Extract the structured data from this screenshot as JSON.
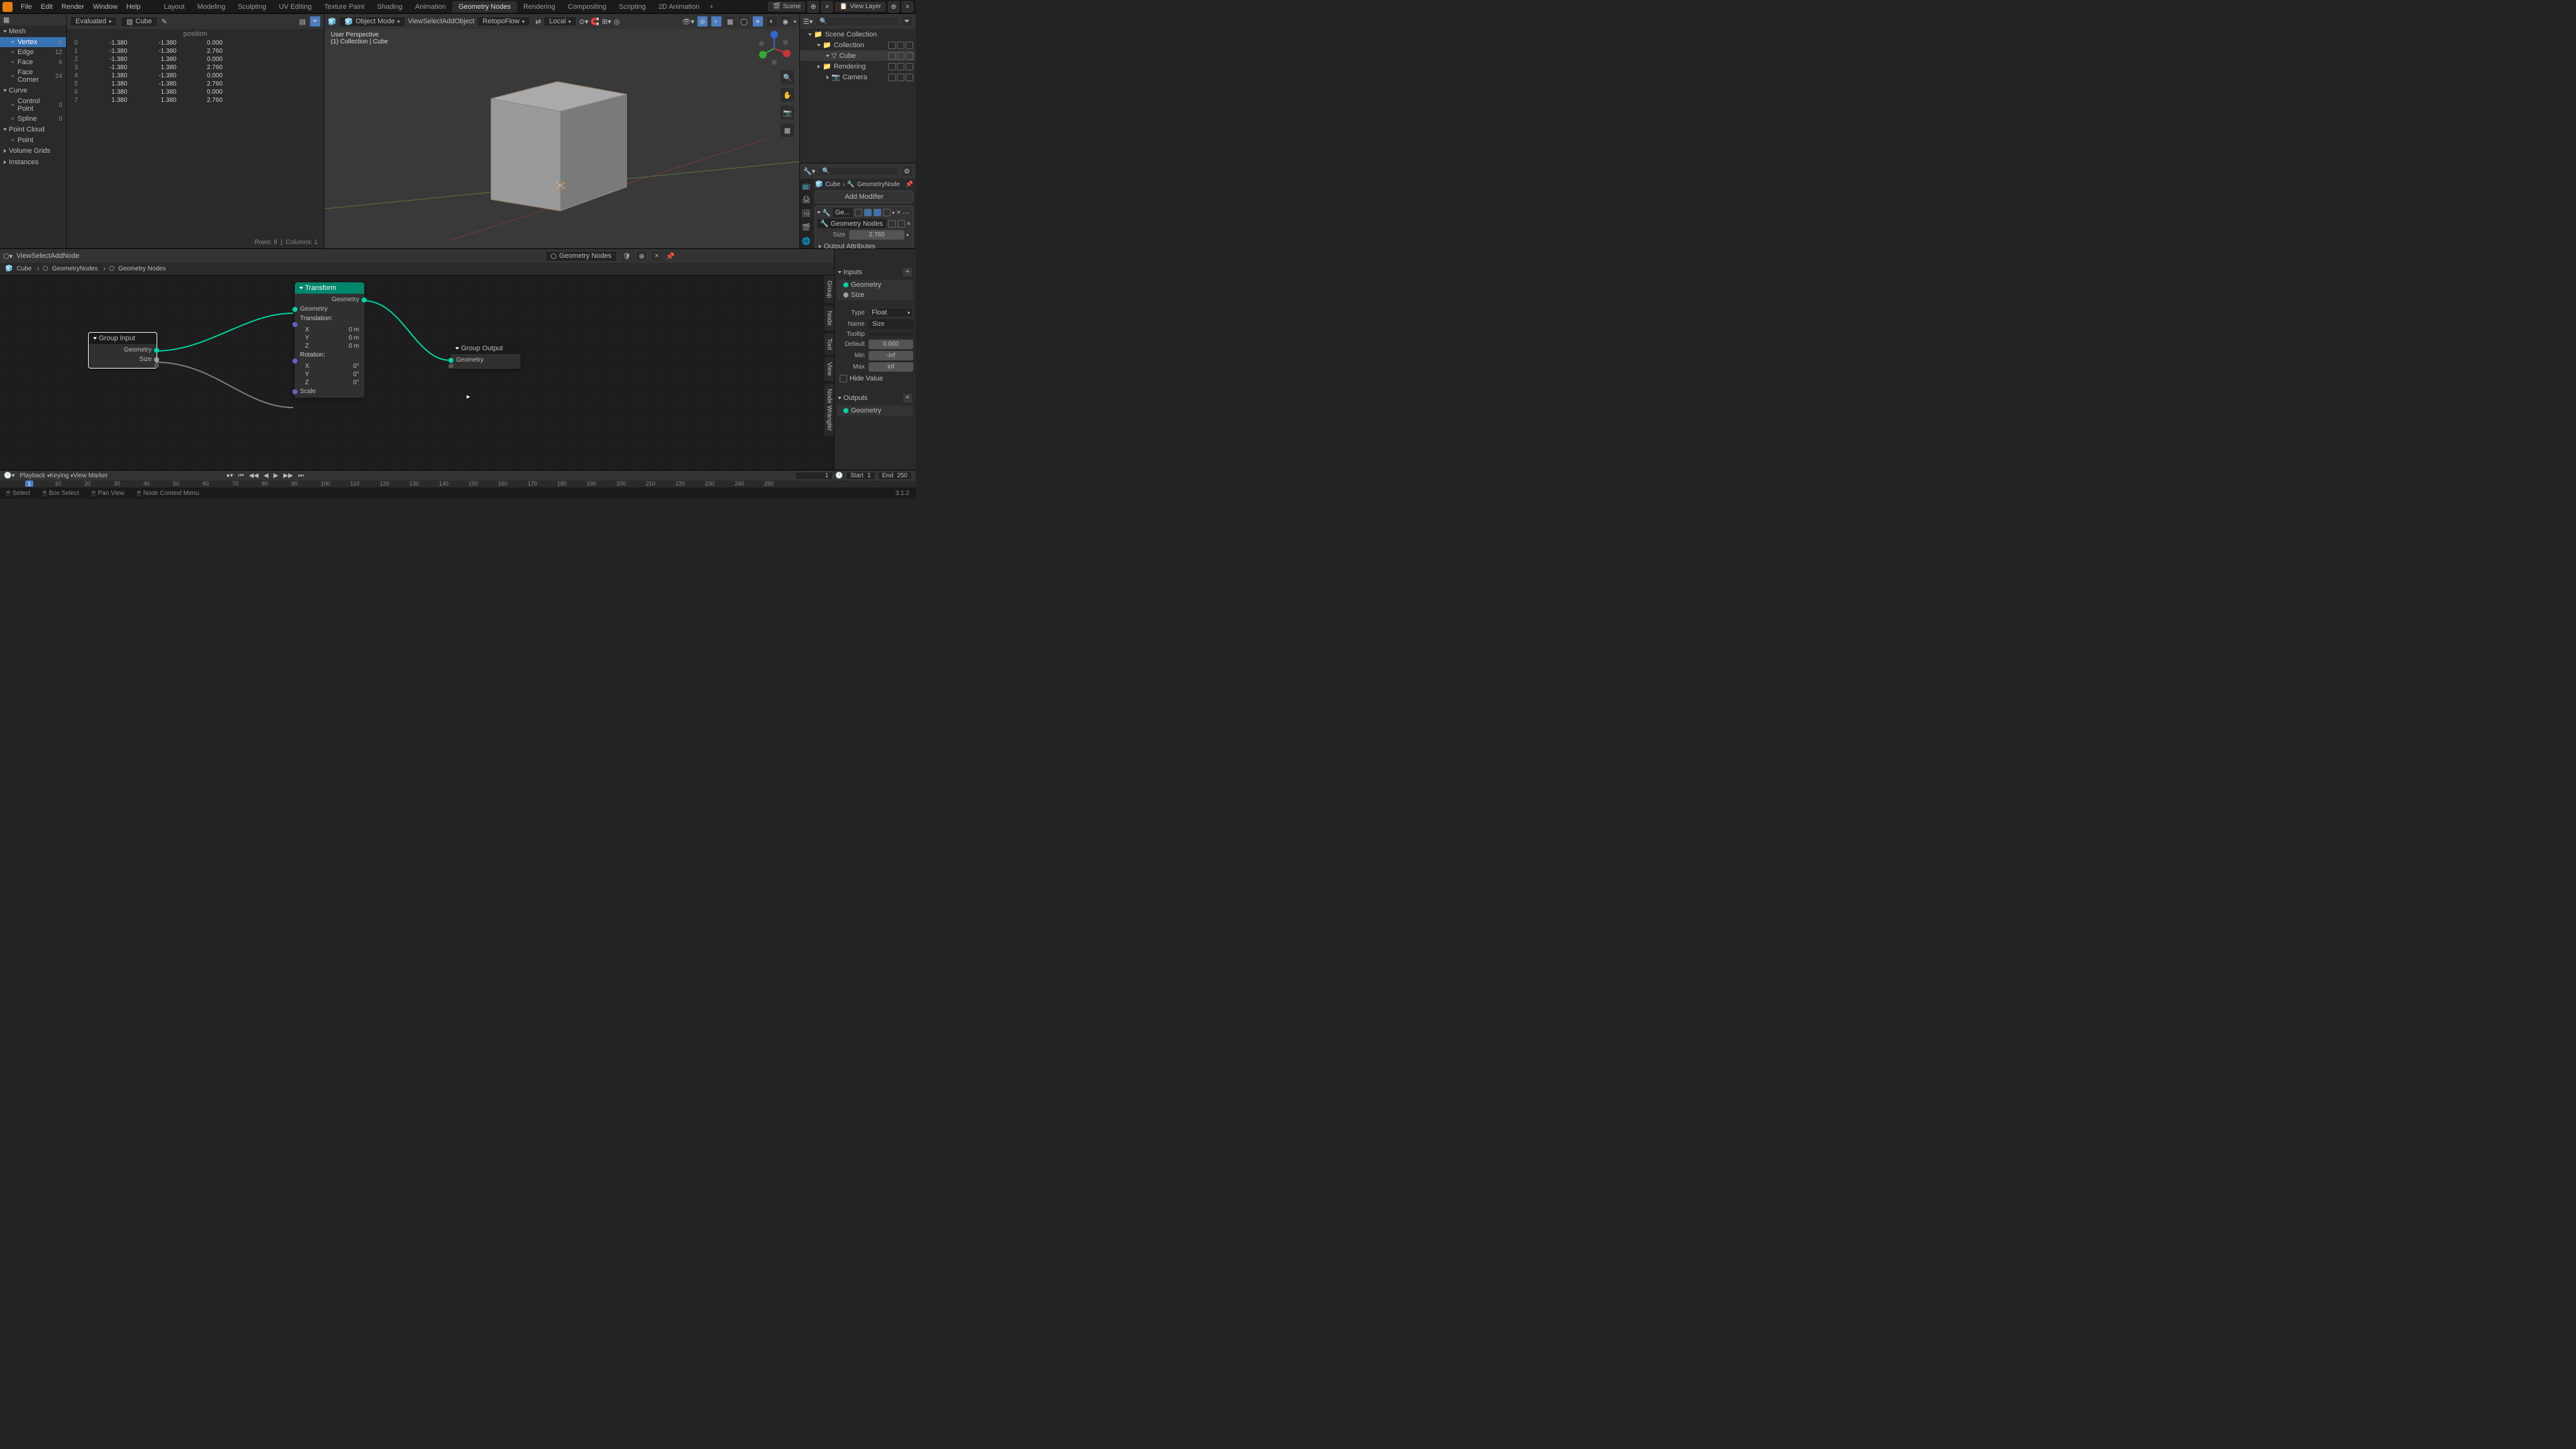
{
  "menu": [
    "File",
    "Edit",
    "Render",
    "Window",
    "Help"
  ],
  "tabs": [
    "Layout",
    "Modeling",
    "Sculpting",
    "UV Editing",
    "Texture Paint",
    "Shading",
    "Animation",
    "Geometry Nodes",
    "Rendering",
    "Compositing",
    "Scripting",
    "2D Animation"
  ],
  "active_tab": "Geometry Nodes",
  "scene": "Scene",
  "view_layer": "View Layer",
  "spreadsheet": {
    "mode": "Evaluated",
    "object": "Cube",
    "column": "position",
    "rows_label": "Rows: 8",
    "cols_label": "Columns: 1",
    "mesh": {
      "title": "Mesh",
      "items": [
        {
          "label": "Vertex",
          "count": "8"
        },
        {
          "label": "Edge",
          "count": "12"
        },
        {
          "label": "Face",
          "count": "6"
        },
        {
          "label": "Face Corner",
          "count": "24"
        }
      ]
    },
    "curve": {
      "title": "Curve",
      "items": [
        {
          "label": "Control Point",
          "count": "0"
        },
        {
          "label": "Spline",
          "count": "0"
        }
      ]
    },
    "pointcloud": {
      "title": "Point Cloud",
      "items": [
        {
          "label": "Point",
          "count": ""
        }
      ]
    },
    "volume": {
      "title": "Volume Grids"
    },
    "instances": {
      "title": "Instances"
    },
    "data": [
      [
        "0",
        "-1.380",
        "-1.380",
        "0.000"
      ],
      [
        "1",
        "-1.380",
        "-1.380",
        "2.760"
      ],
      [
        "2",
        "-1.380",
        "1.380",
        "0.000"
      ],
      [
        "3",
        "-1.380",
        "1.380",
        "2.760"
      ],
      [
        "4",
        "1.380",
        "-1.380",
        "0.000"
      ],
      [
        "5",
        "1.380",
        "-1.380",
        "2.760"
      ],
      [
        "6",
        "1.380",
        "1.380",
        "0.000"
      ],
      [
        "7",
        "1.380",
        "1.380",
        "2.760"
      ]
    ]
  },
  "view3d": {
    "menu": [
      "View",
      "Select",
      "Add",
      "Object"
    ],
    "mode": "Object Mode",
    "retopo": "RetopoFlow",
    "orient": "Local",
    "overlay1": "User Perspective",
    "overlay2": "(1) Collection | Cube"
  },
  "outliner": {
    "root": "Scene Collection",
    "items": [
      {
        "label": "Collection",
        "icon": "collection"
      },
      {
        "label": "Cube",
        "icon": "mesh",
        "selected": true
      },
      {
        "label": "Rendering",
        "icon": "collection"
      },
      {
        "label": "Camera",
        "icon": "camera"
      }
    ]
  },
  "props": {
    "breadcrumb": [
      "Cube",
      "GeometryNode"
    ],
    "add_modifier": "Add Modifier",
    "mod_label": "Ge...",
    "gn_label": "Geometry Nodes",
    "size_label": "Size",
    "size_value": "2.760",
    "output_attrs": "Output Attributes"
  },
  "nodeeditor": {
    "menu": [
      "View",
      "Select",
      "Add",
      "Node"
    ],
    "tree_name": "Geometry Nodes",
    "breadcrumb": [
      "Cube",
      "GeometryNodes",
      "Geometry Nodes"
    ],
    "group_input": {
      "title": "Group Input",
      "outs": [
        {
          "label": "Geometry",
          "type": "geo"
        },
        {
          "label": "Size",
          "type": "flt"
        }
      ]
    },
    "transform": {
      "title": "Transform",
      "out": {
        "label": "Geometry",
        "type": "geo"
      },
      "in_geo": {
        "label": "Geometry",
        "type": "geo"
      },
      "translation": {
        "label": "Translation:",
        "x": "X",
        "xv": "0 m",
        "y": "Y",
        "yv": "0 m",
        "z": "Z",
        "zv": "0 m"
      },
      "rotation": {
        "label": "Rotation:",
        "x": "X",
        "xv": "0°",
        "y": "Y",
        "yv": "0°",
        "z": "Z",
        "zv": "0°"
      },
      "scale": {
        "label": "Scale",
        "type": "vec"
      }
    },
    "group_output": {
      "title": "Group Output",
      "in": {
        "label": "Geometry",
        "type": "geo"
      }
    },
    "sidepanel": {
      "inputs_title": "Inputs",
      "inputs": [
        {
          "label": "Geometry",
          "type": "geo"
        },
        {
          "label": "Size",
          "type": "flt"
        }
      ],
      "type_label": "Type",
      "type_val": "Float",
      "name_label": "Name",
      "name_val": "Size",
      "tooltip_label": "Tooltip",
      "tooltip_val": "",
      "default_label": "Default",
      "default_val": "0.000",
      "min_label": "Min",
      "min_val": "-inf",
      "max_label": "Max",
      "max_val": "inf",
      "hide": "Hide Value",
      "outputs_title": "Outputs",
      "outputs": [
        {
          "label": "Geometry",
          "type": "geo"
        }
      ]
    },
    "side_tabs": [
      "Group",
      "Node",
      "Tool",
      "View",
      "Node Wrangler"
    ]
  },
  "timeline": {
    "menu": [
      "Playback",
      "Keying",
      "View",
      "Marker"
    ],
    "current": "1",
    "start_label": "Start",
    "start": "1",
    "end_label": "End",
    "end": "250",
    "ticks": [
      "10",
      "20",
      "30",
      "40",
      "50",
      "60",
      "70",
      "80",
      "90",
      "100",
      "110",
      "120",
      "130",
      "140",
      "150",
      "160",
      "170",
      "180",
      "190",
      "200",
      "210",
      "220",
      "230",
      "240",
      "250"
    ]
  },
  "status": {
    "select": "Select",
    "box": "Box Select",
    "pan": "Pan View",
    "ctx": "Node Context Menu",
    "version": "3.1.2"
  }
}
